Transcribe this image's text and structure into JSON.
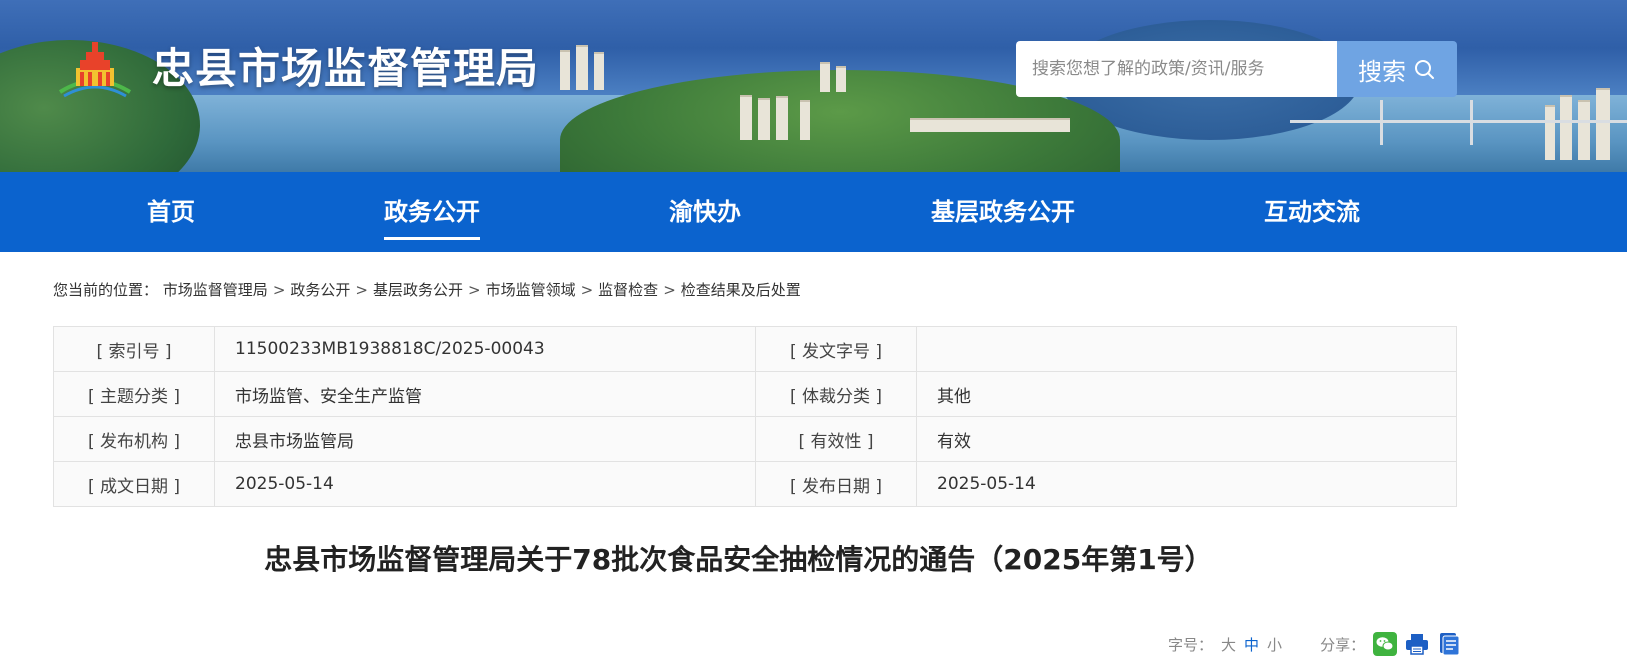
{
  "header": {
    "site_title": "忠县市场监督管理局",
    "search_placeholder": "搜索您想了解的政策/资讯/服务",
    "search_button": "搜索"
  },
  "nav": {
    "items": [
      {
        "label": "首页",
        "active": false
      },
      {
        "label": "政务公开",
        "active": true
      },
      {
        "label": "渝快办",
        "active": false
      },
      {
        "label": "基层政务公开",
        "active": false
      },
      {
        "label": "互动交流",
        "active": false
      }
    ]
  },
  "breadcrumb": {
    "prefix": "您当前的位置：",
    "items": [
      "市场监督管理局",
      "政务公开",
      "基层政务公开",
      "市场监管领域",
      "监督检查",
      "检查结果及后处置"
    ],
    "separator": ">"
  },
  "info": {
    "rows": [
      {
        "l1": "[ 索引号 ]",
        "v1": "11500233MB1938818C/2025-00043",
        "l2": "[ 发文字号 ]",
        "v2": ""
      },
      {
        "l1": "[ 主题分类 ]",
        "v1": "市场监管、安全生产监管",
        "l2": "[ 体裁分类 ]",
        "v2": "其他"
      },
      {
        "l1": "[ 发布机构 ]",
        "v1": "忠县市场监管局",
        "l2": "[ 有效性 ]",
        "v2": "有效"
      },
      {
        "l1": "[ 成文日期 ]",
        "v1": "2025-05-14",
        "l2": "[ 发布日期 ]",
        "v2": "2025-05-14"
      }
    ]
  },
  "article": {
    "title": "忠县市场监督管理局关于78批次食品安全抽检情况的通告（2025年第1号）"
  },
  "tools": {
    "font_size_label": "字号：",
    "sizes": [
      "大",
      "中",
      "小"
    ],
    "active_size": "中",
    "share_label": "分享：",
    "icons": [
      "wechat-icon",
      "print-icon",
      "document-icon"
    ]
  },
  "colors": {
    "nav_bg": "#0b63ce",
    "search_button_bg": "#6fa4e3",
    "wechat": "#3fb33f",
    "icon_blue": "#1d5fc4"
  }
}
